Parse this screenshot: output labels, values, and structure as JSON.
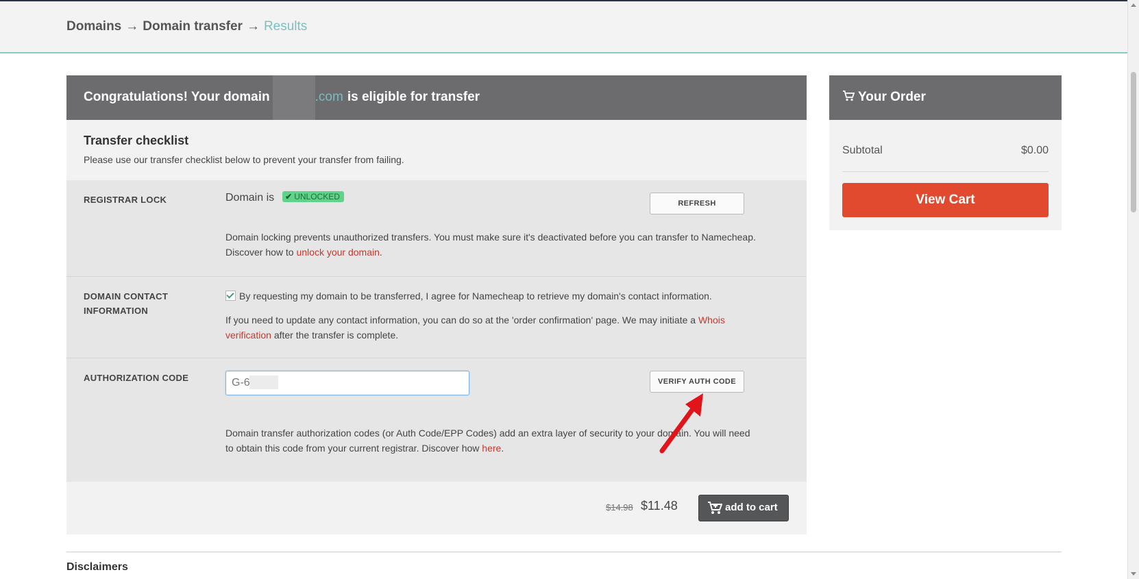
{
  "breadcrumb": {
    "items": [
      "Domains",
      "Domain transfer"
    ],
    "current": "Results",
    "separator": "→"
  },
  "card": {
    "title_before": "Congratulations! Your domain",
    "domain_tld": ".com",
    "title_after": "is eligible for transfer",
    "checklist_title": "Transfer checklist",
    "checklist_subtitle": "Please use our transfer checklist below to prevent your transfer from failing."
  },
  "registrar_lock": {
    "label": "REGISTRAR LOCK",
    "status_prefix": "Domain is",
    "status_badge": "UNLOCKED",
    "refresh_label": "REFRESH",
    "description": "Domain locking prevents unauthorized transfers. You must make sure it's deactivated before you can transfer to Namecheap.",
    "discover_prefix": "Discover how to",
    "discover_link": "unlock your domain",
    "discover_suffix": "."
  },
  "contact_info": {
    "label_line1": "DOMAIN CONTACT",
    "label_line2": "INFORMATION",
    "agree_text": "By requesting my domain to be transferred, I agree for Namecheap to retrieve my domain's contact information.",
    "note_line1": "If you need to update any contact information, you can do so at the 'order confirmation' page. We may initiate a",
    "note_link_part1": "Whois",
    "note_link_part2": "verification",
    "note_suffix": "after the transfer is complete."
  },
  "auth_code": {
    "label": "AUTHORIZATION CODE",
    "value": "G-6",
    "verify_label": "VERIFY AUTH CODE",
    "description_line1": "Domain transfer authorization codes (or Auth Code/EPP Codes) add an extra layer of security to your domain. You will need",
    "description_line2_prefix": "to obtain this code from your current registrar. Discover how",
    "description_link": "here",
    "description_suffix": "."
  },
  "pricing": {
    "old_price": "$14.98",
    "new_price": "$11.48",
    "add_to_cart_label": "add to cart"
  },
  "order": {
    "title": "Your Order",
    "subtotal_label": "Subtotal",
    "subtotal_value": "$0.00",
    "view_cart_label": "View Cart"
  },
  "disclaimers": "Disclaimers",
  "colors": {
    "header_gray": "#6c6c6e",
    "accent_teal": "#7bbfc1",
    "link_red": "#c8372b",
    "view_cart_red": "#e24a2f",
    "badge_green": "#5fd38a"
  },
  "icons": {
    "cart": "cart-icon",
    "check": "check-icon",
    "annotation": "red-arrow-icon"
  }
}
